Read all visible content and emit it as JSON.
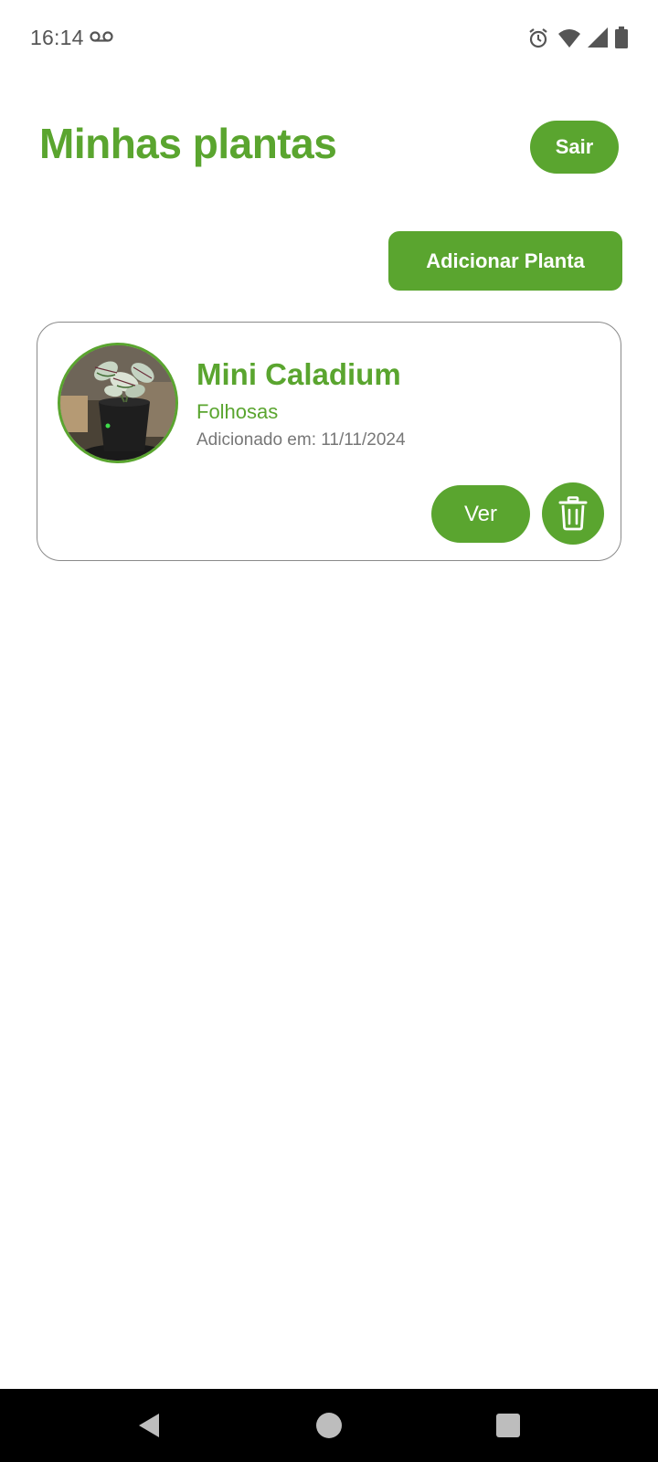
{
  "status_bar": {
    "time": "16:14",
    "icons": [
      "voicemail-icon",
      "alarm-icon",
      "wifi-icon",
      "cell-signal-icon",
      "battery-icon"
    ]
  },
  "header": {
    "title": "Minhas plantas",
    "logout_label": "Sair"
  },
  "actions": {
    "add_plant_label": "Adicionar Planta"
  },
  "plants": [
    {
      "name": "Mini Caladium",
      "category": "Folhosas",
      "added_label": "Adicionado em: 11/11/2024",
      "view_label": "Ver",
      "delete_icon": "trash-icon",
      "photo": "plant-photo"
    }
  ],
  "nav_bar": {
    "icons": [
      "back-icon",
      "home-icon",
      "recents-icon"
    ]
  },
  "colors": {
    "accent": "#5aa52f",
    "muted_text": "#777777",
    "card_border": "#8a8a8a"
  }
}
